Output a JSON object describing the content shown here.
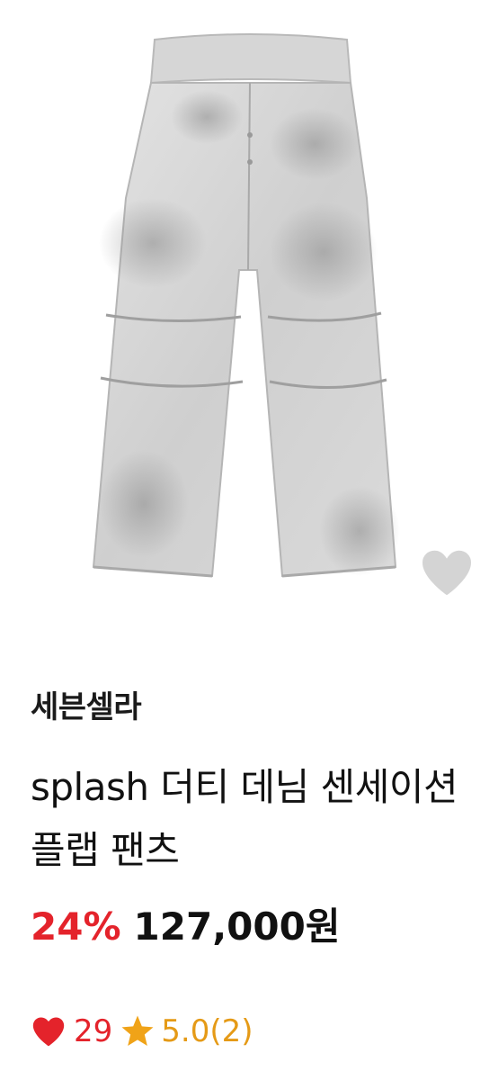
{
  "product": {
    "image_description_icon": "pants-photo",
    "brand": "세븐셀라",
    "title": "splash 더티 데님 센세이션 플랩 팬츠",
    "discount": "24%",
    "price": "127,000원",
    "likes": "29",
    "rating": "5.0(2)"
  },
  "icons": {
    "wishlist": "heart-outline-icon",
    "likes": "heart-icon",
    "rating": "star-icon"
  },
  "colors": {
    "accent_red": "#e4232b",
    "star_orange": "#e59a16",
    "wish_heart": "#d4d4d4",
    "text": "#111111"
  }
}
